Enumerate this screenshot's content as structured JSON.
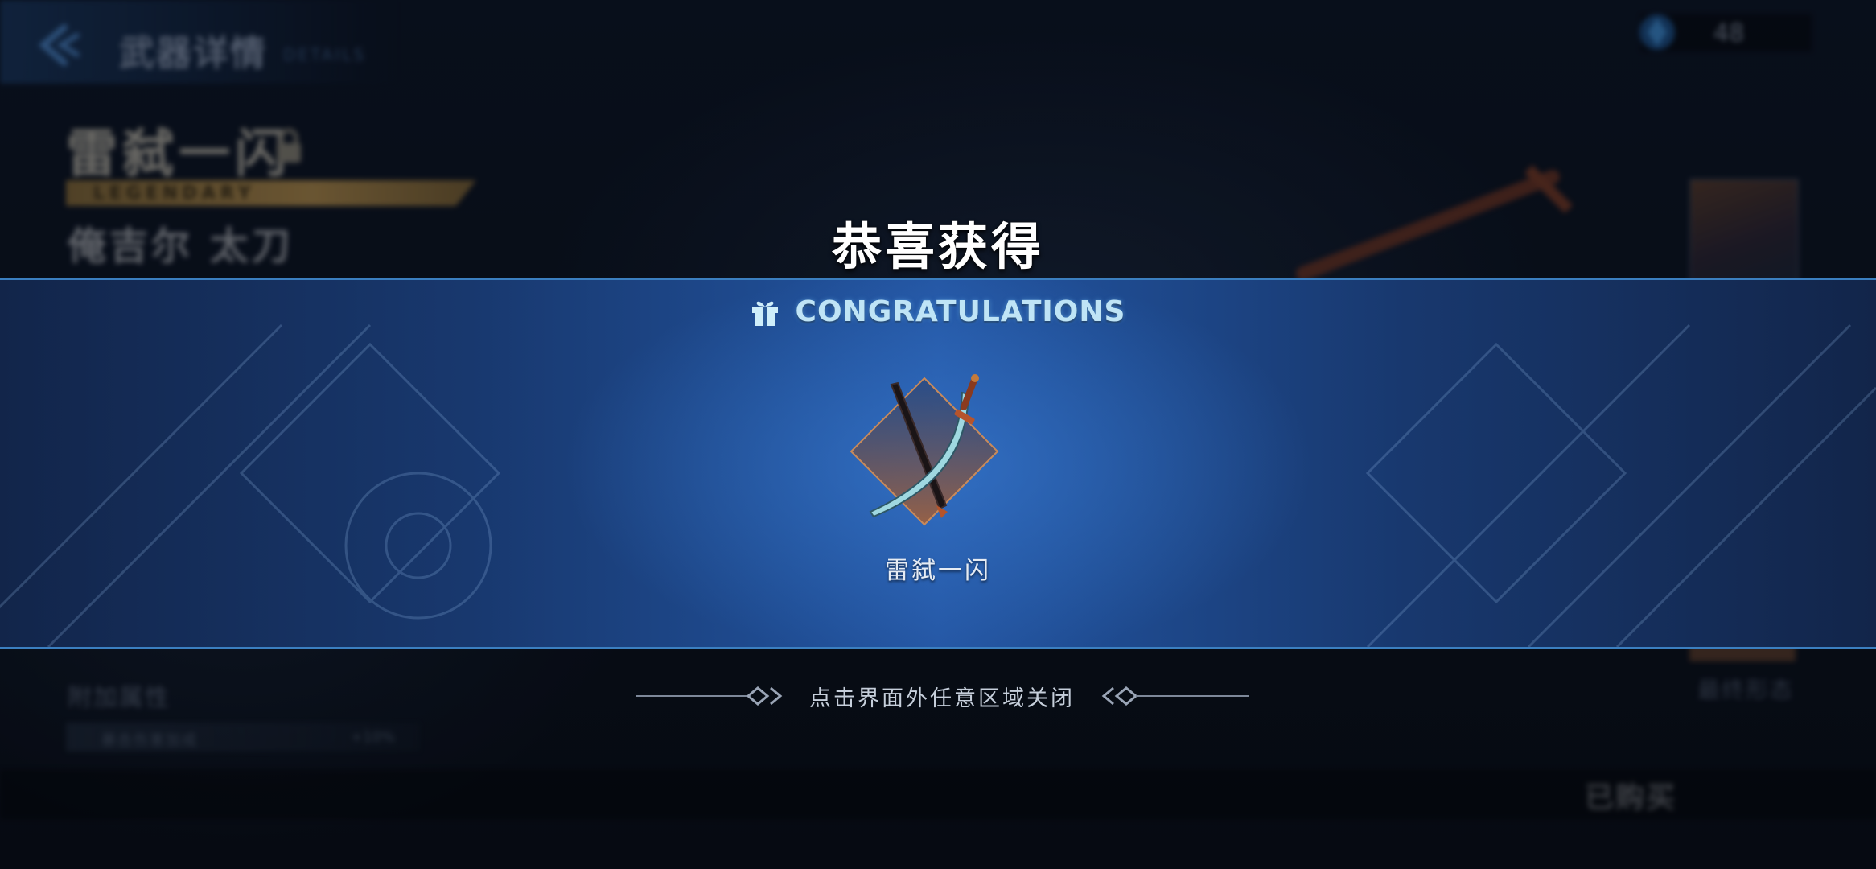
{
  "background_page": {
    "header": {
      "title": "武器详情",
      "subtitle": "DETAILS"
    },
    "currency": {
      "icon": "crystal-icon",
      "value": "48"
    },
    "weapon": {
      "name": "雷弑一闪",
      "rarity": "LEGENDARY",
      "type": "俺吉尔 太刀"
    },
    "attributes": {
      "label": "附加属性",
      "row_text": "暴击伤害加成",
      "row_value": "+10%"
    },
    "final_form_label": "最终形态",
    "purchase_status": "已购买"
  },
  "reward_popup": {
    "title": "恭喜获得",
    "subtitle": "CONGRATULATIONS",
    "subtitle_icon": "gift-icon",
    "item": {
      "name": "雷弑一闪",
      "icon": "katana-icon",
      "frame_color": "#c98a5a"
    },
    "close_hint": "点击界面外任意区域关闭"
  },
  "colors": {
    "band_blue": "#2456a3",
    "band_border": "#3b7fc0",
    "congrats_text": "#bfe4f6",
    "rarity_gold": "#b8904a"
  }
}
